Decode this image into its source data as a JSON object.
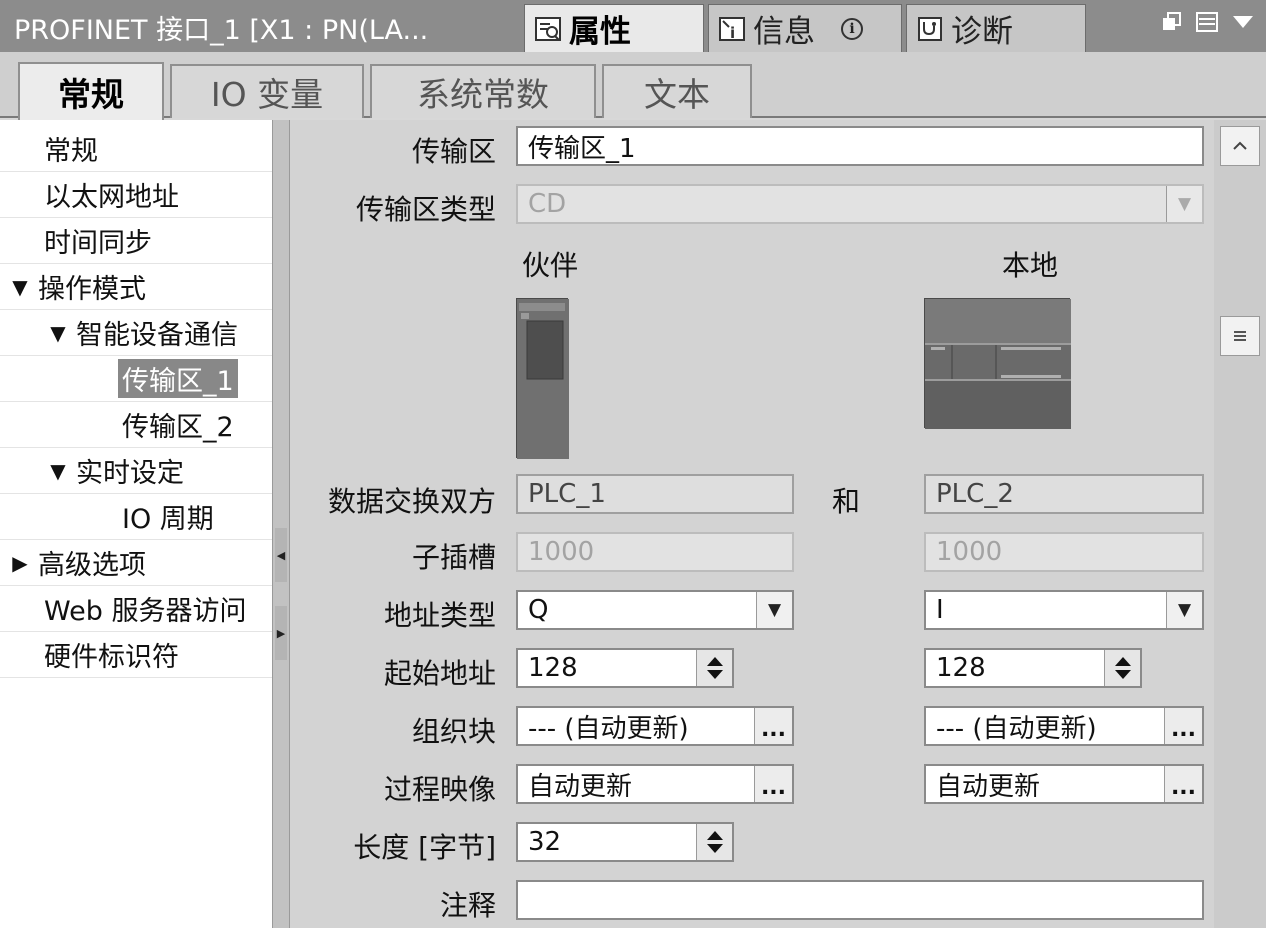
{
  "title": "PROFINET 接口_1 [X1 : PN(LA...",
  "panel_tabs": [
    {
      "label": "属性",
      "icon": "properties-icon",
      "active": true
    },
    {
      "label": "信息",
      "icon": "info-icon",
      "active": false
    },
    {
      "label": "诊断",
      "icon": "diagnostics-icon",
      "active": false
    }
  ],
  "main_tabs": [
    {
      "label": "常规",
      "active": true
    },
    {
      "label": "IO 变量",
      "active": false
    },
    {
      "label": "系统常数",
      "active": false
    },
    {
      "label": "文本",
      "active": false
    }
  ],
  "nav": [
    {
      "label": "常规",
      "level": 0,
      "caret": ""
    },
    {
      "label": "以太网地址",
      "level": 0,
      "caret": ""
    },
    {
      "label": "时间同步",
      "level": 0,
      "caret": ""
    },
    {
      "label": "操作模式",
      "level": 0,
      "caret": "▼"
    },
    {
      "label": "智能设备通信",
      "level": 1,
      "caret": "▼"
    },
    {
      "label": "传输区_1",
      "level": 2,
      "caret": "",
      "selected": true
    },
    {
      "label": "传输区_2",
      "level": 2,
      "caret": ""
    },
    {
      "label": "实时设定",
      "level": 1,
      "caret": "▼"
    },
    {
      "label": "IO 周期",
      "level": 2,
      "caret": ""
    },
    {
      "label": "高级选项",
      "level": 0,
      "caret": "▶"
    },
    {
      "label": "Web 服务器访问",
      "level": 0,
      "caret": ""
    },
    {
      "label": "硬件标识符",
      "level": 0,
      "caret": ""
    }
  ],
  "form": {
    "transfer_area_label": "传输区",
    "transfer_area_value": "传输区_1",
    "transfer_type_label": "传输区类型",
    "transfer_type_value": "CD",
    "partner_heading": "伙伴",
    "local_heading": "本地",
    "exchange_label": "数据交换双方",
    "exchange_and": "和",
    "partner_plc": "PLC_1",
    "local_plc": "PLC_2",
    "subslot_label": "子插槽",
    "partner_subslot": "1000",
    "local_subslot": "1000",
    "address_type_label": "地址类型",
    "partner_address_type": "Q",
    "local_address_type": "I",
    "start_address_label": "起始地址",
    "partner_start_address": "128",
    "local_start_address": "128",
    "org_block_label": "组织块",
    "partner_org_block": "--- (自动更新)",
    "local_org_block": "--- (自动更新)",
    "process_image_label": "过程映像",
    "partner_process_image": "自动更新",
    "local_process_image": "自动更新",
    "length_label": "长度 [字节]",
    "length_value": "32",
    "comment_label": "注释",
    "comment_value": "",
    "ellipsis": "...",
    "dropdown_glyph": "▼"
  },
  "colors": {
    "titlebar": "#8c8c8c",
    "panel": "#d3d3d3",
    "nav_selected": "#888888"
  }
}
